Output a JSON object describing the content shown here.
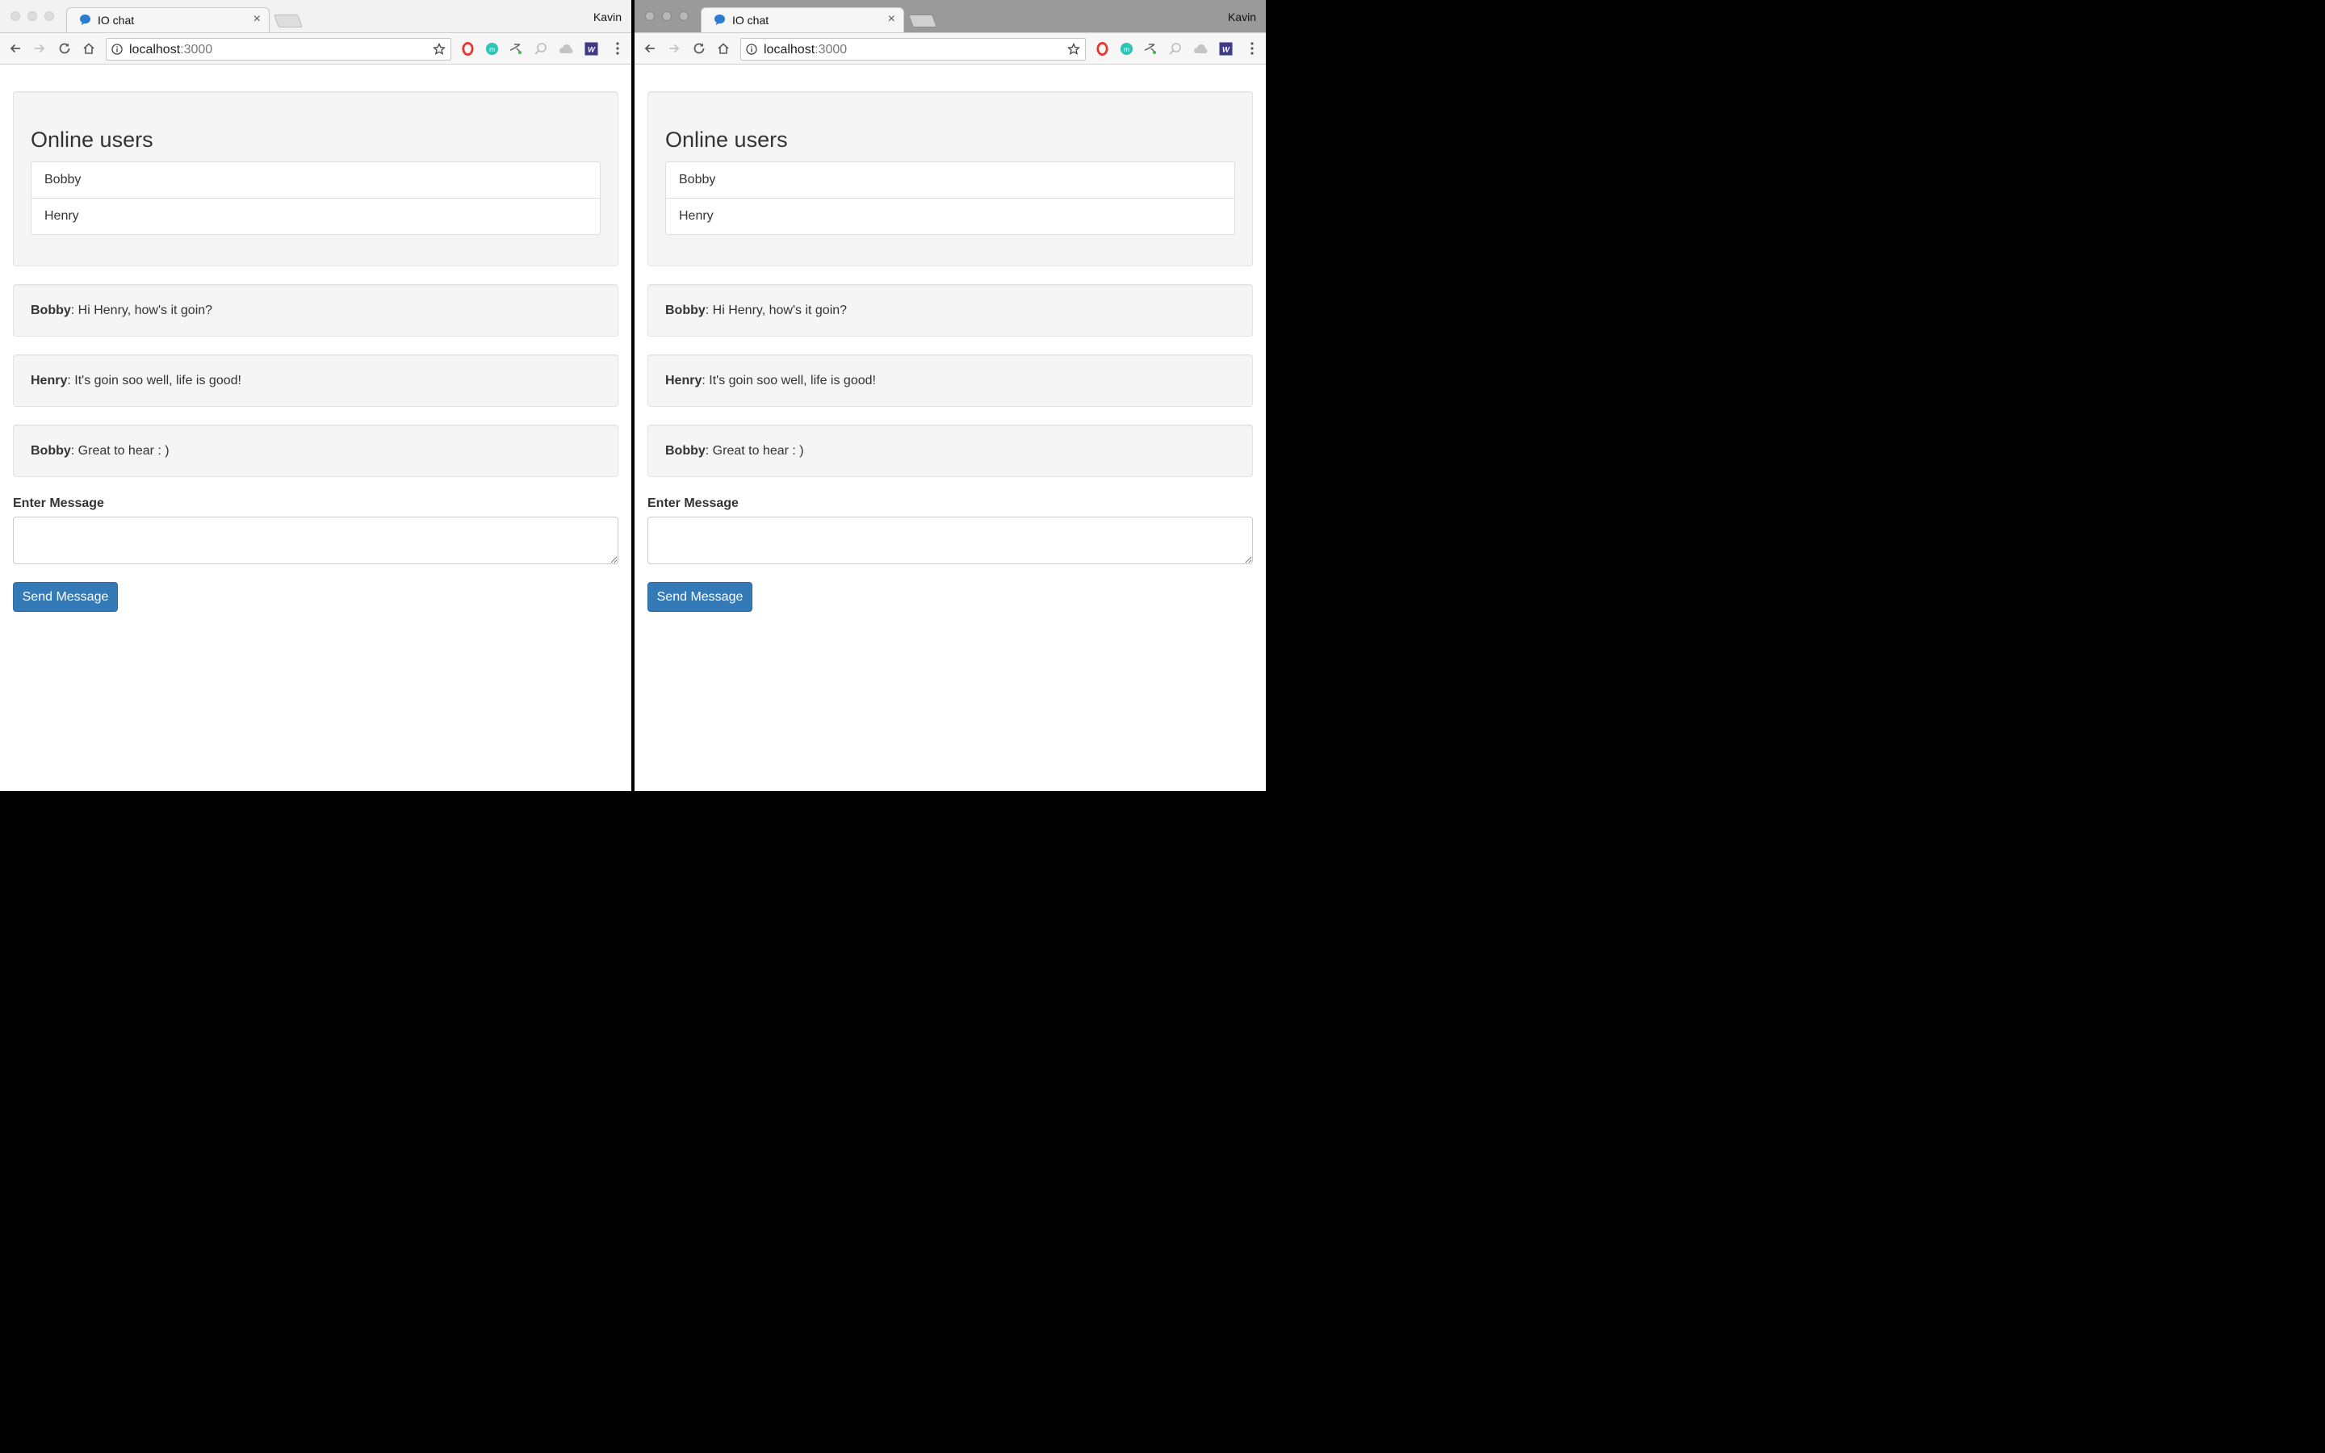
{
  "browser": {
    "tab_title": "IO chat",
    "tab_close": "×",
    "profile_name": "Kavin",
    "url_host": "localhost",
    "url_port": ":3000",
    "extension_icons": [
      "opera-icon",
      "m-extension-icon",
      "translate-icon",
      "lens-icon",
      "drive-icon",
      "w-extension-icon"
    ]
  },
  "page": {
    "users_title": "Online users",
    "users": [
      "Bobby",
      "Henry"
    ],
    "messages": [
      {
        "sender": "Bobby",
        "text": ": Hi Henry, how's it goin?"
      },
      {
        "sender": "Henry",
        "text": ": It's goin soo well, life is good!"
      },
      {
        "sender": "Bobby",
        "text": ": Great to hear : )"
      }
    ],
    "input_label": "Enter Message",
    "input_value": "",
    "send_label": "Send Message"
  },
  "colors": {
    "primary_button": "#337ab7",
    "well_background": "#f5f5f5",
    "favicon": "#2d7bd0"
  }
}
